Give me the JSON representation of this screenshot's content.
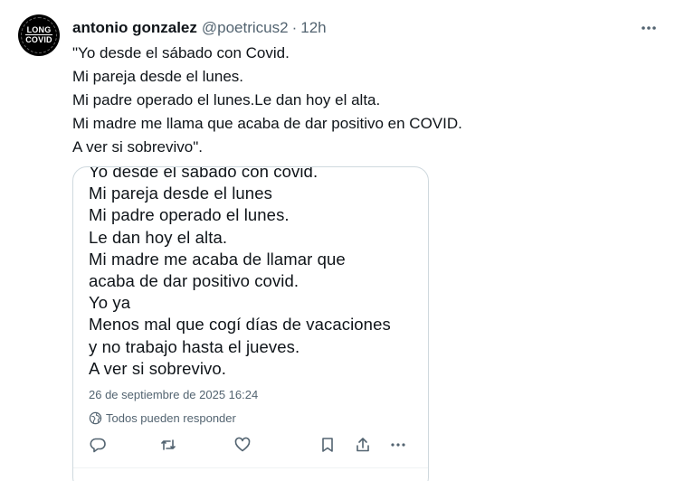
{
  "tweet": {
    "author_name": "antonio gonzalez",
    "handle": "@poetricus2",
    "separator": "·",
    "time": "12h",
    "avatar_text_top": "LONG",
    "avatar_text_bottom": "COVID",
    "text_lines": [
      "\"Yo desde el sábado con Covid.",
      "Mi pareja desde el lunes.",
      "Mi padre operado el lunes.Le dan hoy el alta.",
      "Mi madre me llama que acaba de dar positivo en COVID.",
      "A ver si sobrevivo\"."
    ]
  },
  "embedded": {
    "text_lines": [
      "Yo desde el sábado con covid.",
      "Mi pareja desde el lunes",
      "Mi padre operado el lunes.",
      "Le dan hoy el alta.",
      "Mi madre me acaba de llamar que",
      "acaba de dar positivo covid.",
      "Yo ya",
      "Menos mal que cogí días de vacaciones",
      "y no trabajo hasta el jueves.",
      "A ver si sobrevivo."
    ],
    "date": "26 de septiembre de 2025 16:24",
    "reply_setting": "Todos pueden responder",
    "icons": {
      "reply_setting": "globe-icon",
      "actions": [
        "reply-icon",
        "retweet-icon",
        "like-icon",
        "bookmark-icon",
        "share-icon",
        "more-icon"
      ]
    }
  },
  "colors": {
    "text": "#0f1419",
    "secondary": "#536471",
    "border": "#cfd9de"
  }
}
